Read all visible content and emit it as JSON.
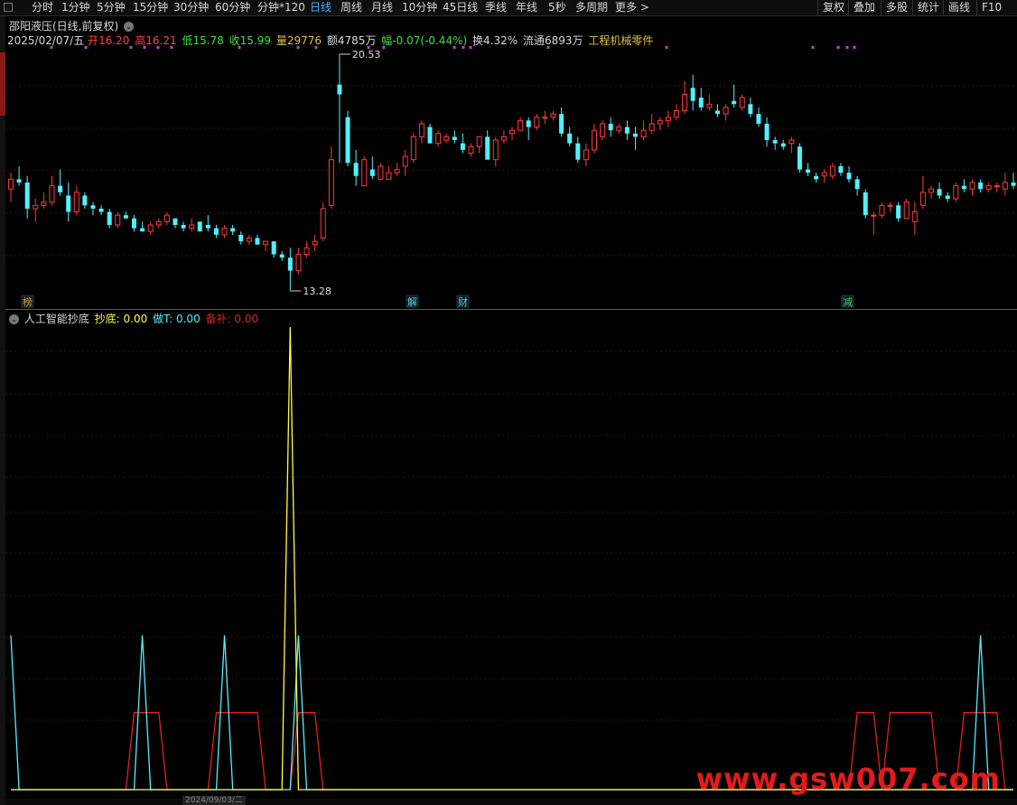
{
  "toolbar": {
    "periods": [
      {
        "label": "分时",
        "active": false
      },
      {
        "label": "1分钟",
        "active": false
      },
      {
        "label": "5分钟",
        "active": false
      },
      {
        "label": "15分钟",
        "active": false
      },
      {
        "label": "30分钟",
        "active": false
      },
      {
        "label": "60分钟",
        "active": false
      },
      {
        "label": "分钟*120",
        "active": false
      },
      {
        "label": "日线",
        "active": true
      },
      {
        "label": "周线",
        "active": false
      },
      {
        "label": "月线",
        "active": false
      },
      {
        "label": "10分钟",
        "active": false
      },
      {
        "label": "45日线",
        "active": false
      },
      {
        "label": "季线",
        "active": false
      },
      {
        "label": "年线",
        "active": false
      },
      {
        "label": "5秒",
        "active": false
      },
      {
        "label": "多周期",
        "active": false
      },
      {
        "label": "更多",
        "active": false
      }
    ],
    "right": [
      "复权",
      "叠加",
      "多股",
      "统计",
      "画线",
      "F10"
    ]
  },
  "stock": {
    "title": "邵阳液压(日线,前复权)",
    "date": "2025/02/07/五",
    "open_label": "开",
    "open": "16.20",
    "high_label": "高",
    "high": "16.21",
    "low_label": "低",
    "low": "15.78",
    "close_label": "收",
    "close": "15.99",
    "vol_label": "量",
    "volume": "29776",
    "amount_label": "额",
    "amount": "4785万",
    "change_label": "幅",
    "change": "-0.07(-0.44%)",
    "turnover_label": "换",
    "turnover": "4.32%",
    "float_label": "流通",
    "float_shares": "6893万",
    "industry": "工程机械零件",
    "max_label": "20.53",
    "min_label": "13.28"
  },
  "event_tags": [
    {
      "text": "榜",
      "color": "#e8a040"
    },
    {
      "text": "解",
      "color": "#4fd0e0"
    },
    {
      "text": "财",
      "color": "#4fd0e0"
    },
    {
      "text": "减",
      "color": "#50d050"
    }
  ],
  "indicator": {
    "name": "人工智能抄底",
    "l1_label": "抄底:",
    "l1_value": "0.00",
    "l2_label": "做T:",
    "l2_value": "0.00",
    "l3_label": "备补:",
    "l3_value": "0.00"
  },
  "date_axis": {
    "tick": "2024/09/03/二"
  },
  "watermark": "www.gsw007.com",
  "colors": {
    "up": "#ff3a3a",
    "down": "#52f0ff",
    "chaodi": "#ffff40",
    "zuot": "#52f0ff",
    "beibu": "#e02020"
  },
  "chart_data": [
    {
      "type": "candlestick",
      "title": "邵阳液压(日线,前复权)",
      "ylim": [
        13.28,
        20.53
      ],
      "max_value": 20.53,
      "min_value": 13.28,
      "candles": [
        [
          16.4,
          16.9,
          16.0,
          16.7
        ],
        [
          16.7,
          17.1,
          16.5,
          16.6
        ],
        [
          16.6,
          16.8,
          15.5,
          15.8
        ],
        [
          15.8,
          16.1,
          15.4,
          15.9
        ],
        [
          15.9,
          16.3,
          15.8,
          16.0
        ],
        [
          16.0,
          16.8,
          15.9,
          16.5
        ],
        [
          16.5,
          17.0,
          16.2,
          16.3
        ],
        [
          16.2,
          16.6,
          15.4,
          15.7
        ],
        [
          15.7,
          16.5,
          15.6,
          16.3
        ],
        [
          16.2,
          16.3,
          15.8,
          15.9
        ],
        [
          15.9,
          16.0,
          15.6,
          15.8
        ],
        [
          15.8,
          15.9,
          15.6,
          15.7
        ],
        [
          15.7,
          15.8,
          15.2,
          15.3
        ],
        [
          15.3,
          15.7,
          15.2,
          15.6
        ],
        [
          15.6,
          15.7,
          15.5,
          15.5
        ],
        [
          15.5,
          15.6,
          15.1,
          15.2
        ],
        [
          15.2,
          15.4,
          15.1,
          15.1
        ],
        [
          15.1,
          15.4,
          15.0,
          15.3
        ],
        [
          15.3,
          15.5,
          15.2,
          15.4
        ],
        [
          15.4,
          15.7,
          15.3,
          15.6
        ],
        [
          15.5,
          15.5,
          15.2,
          15.3
        ],
        [
          15.3,
          15.4,
          15.1,
          15.2
        ],
        [
          15.2,
          15.5,
          15.1,
          15.3
        ],
        [
          15.4,
          15.4,
          15.1,
          15.1
        ],
        [
          15.3,
          15.6,
          15.1,
          15.2
        ],
        [
          15.2,
          15.3,
          14.9,
          15.0
        ],
        [
          15.0,
          15.3,
          14.9,
          15.2
        ],
        [
          15.2,
          15.3,
          15.0,
          15.1
        ],
        [
          15.0,
          15.1,
          14.7,
          14.8
        ],
        [
          14.8,
          15.0,
          14.7,
          14.9
        ],
        [
          14.9,
          15.0,
          14.7,
          14.7
        ],
        [
          14.7,
          14.8,
          14.5,
          14.8
        ],
        [
          14.8,
          14.8,
          14.3,
          14.4
        ],
        [
          14.4,
          14.5,
          14.2,
          14.3
        ],
        [
          14.3,
          14.6,
          13.28,
          13.9
        ],
        [
          13.9,
          14.6,
          13.8,
          14.4
        ],
        [
          14.4,
          14.8,
          14.3,
          14.6
        ],
        [
          14.7,
          15.0,
          14.5,
          14.8
        ],
        [
          14.9,
          16.0,
          14.8,
          15.8
        ],
        [
          15.9,
          17.7,
          15.8,
          17.3
        ],
        [
          19.6,
          20.53,
          17.2,
          19.3
        ],
        [
          18.6,
          18.8,
          17.1,
          17.2
        ],
        [
          17.2,
          17.6,
          16.5,
          16.8
        ],
        [
          16.5,
          17.4,
          16.5,
          17.3
        ],
        [
          17.0,
          17.4,
          16.7,
          16.8
        ],
        [
          16.7,
          17.2,
          16.7,
          17.1
        ],
        [
          16.7,
          17.1,
          16.7,
          16.9
        ],
        [
          16.9,
          17.2,
          16.8,
          17.0
        ],
        [
          17.1,
          17.6,
          16.8,
          17.4
        ],
        [
          17.3,
          18.1,
          17.2,
          18.0
        ],
        [
          18.0,
          18.5,
          17.8,
          18.4
        ],
        [
          18.3,
          18.4,
          17.8,
          17.8
        ],
        [
          17.8,
          18.2,
          17.7,
          18.1
        ],
        [
          17.9,
          18.1,
          17.8,
          18.0
        ],
        [
          18.0,
          18.2,
          17.8,
          17.9
        ],
        [
          17.8,
          18.1,
          17.5,
          17.6
        ],
        [
          17.5,
          17.8,
          17.4,
          17.7
        ],
        [
          17.7,
          18.0,
          17.5,
          18.0
        ],
        [
          18.0,
          18.2,
          17.4,
          17.3
        ],
        [
          17.3,
          18.0,
          17.1,
          17.9
        ],
        [
          17.9,
          18.2,
          17.8,
          18.0
        ],
        [
          18.1,
          18.3,
          17.9,
          18.2
        ],
        [
          18.2,
          18.6,
          18.2,
          18.5
        ],
        [
          18.5,
          18.6,
          17.9,
          18.3
        ],
        [
          18.3,
          18.7,
          18.2,
          18.6
        ],
        [
          18.6,
          18.8,
          18.4,
          18.6
        ],
        [
          18.6,
          18.8,
          18.5,
          18.7
        ],
        [
          18.7,
          18.9,
          18.0,
          18.1
        ],
        [
          18.1,
          18.3,
          17.7,
          17.8
        ],
        [
          17.8,
          18.0,
          17.2,
          17.3
        ],
        [
          17.3,
          17.8,
          17.1,
          17.6
        ],
        [
          17.6,
          18.4,
          17.5,
          18.2
        ],
        [
          18.0,
          18.5,
          17.9,
          18.4
        ],
        [
          18.4,
          18.6,
          18.0,
          18.2
        ],
        [
          18.2,
          18.4,
          18.1,
          18.3
        ],
        [
          18.3,
          18.5,
          17.9,
          18.1
        ],
        [
          18.1,
          18.3,
          17.6,
          18.0
        ],
        [
          18.0,
          18.5,
          17.9,
          18.2
        ],
        [
          18.2,
          18.7,
          18.1,
          18.4
        ],
        [
          18.4,
          18.6,
          18.2,
          18.5
        ],
        [
          18.5,
          18.8,
          18.3,
          18.6
        ],
        [
          18.6,
          19.0,
          18.5,
          18.8
        ],
        [
          18.8,
          19.7,
          18.7,
          19.3
        ],
        [
          19.5,
          19.9,
          18.8,
          19.1
        ],
        [
          19.2,
          19.5,
          18.8,
          18.9
        ],
        [
          18.9,
          19.3,
          18.8,
          19.0
        ],
        [
          18.8,
          19.0,
          18.6,
          18.7
        ],
        [
          18.7,
          19.0,
          18.5,
          18.9
        ],
        [
          19.1,
          19.6,
          18.9,
          19.0
        ],
        [
          18.9,
          19.3,
          18.8,
          19.2
        ],
        [
          19.0,
          19.2,
          18.6,
          18.7
        ],
        [
          18.7,
          18.9,
          18.3,
          18.4
        ],
        [
          18.4,
          18.6,
          17.7,
          17.9
        ],
        [
          17.9,
          18.0,
          17.6,
          17.8
        ],
        [
          17.8,
          17.9,
          17.6,
          17.7
        ],
        [
          17.8,
          18.0,
          17.5,
          17.9
        ],
        [
          17.7,
          17.8,
          16.9,
          17.0
        ],
        [
          17.0,
          17.2,
          16.8,
          16.9
        ],
        [
          16.8,
          16.9,
          16.6,
          16.7
        ],
        [
          16.8,
          17.0,
          16.6,
          16.9
        ],
        [
          16.8,
          17.2,
          16.7,
          17.1
        ],
        [
          17.1,
          17.2,
          16.8,
          16.9
        ],
        [
          16.9,
          17.1,
          16.6,
          16.7
        ],
        [
          16.7,
          16.8,
          16.2,
          16.4
        ],
        [
          16.3,
          16.4,
          15.5,
          15.6
        ],
        [
          15.6,
          15.7,
          15.0,
          15.6
        ],
        [
          15.6,
          16.0,
          15.5,
          15.9
        ],
        [
          15.9,
          16.0,
          15.7,
          15.9
        ],
        [
          15.9,
          16.0,
          15.4,
          15.5
        ],
        [
          15.5,
          16.1,
          15.5,
          16.0
        ],
        [
          15.4,
          16.0,
          15.0,
          15.7
        ],
        [
          15.9,
          16.8,
          15.8,
          16.3
        ],
        [
          16.3,
          16.5,
          16.1,
          16.4
        ],
        [
          16.4,
          16.6,
          16.1,
          16.2
        ],
        [
          16.2,
          16.3,
          16.0,
          16.1
        ],
        [
          16.1,
          16.6,
          16.0,
          16.5
        ],
        [
          16.5,
          16.7,
          16.3,
          16.4
        ],
        [
          16.4,
          16.7,
          16.2,
          16.6
        ],
        [
          16.6,
          16.7,
          16.3,
          16.4
        ],
        [
          16.4,
          16.6,
          16.3,
          16.5
        ],
        [
          16.5,
          16.6,
          16.3,
          16.5
        ],
        [
          16.4,
          16.9,
          16.2,
          16.6
        ],
        [
          16.6,
          16.9,
          16.4,
          16.5
        ]
      ]
    },
    {
      "type": "line",
      "title": "人工智能抄底",
      "ylim": [
        0,
        3
      ],
      "series": [
        {
          "name": "抄底",
          "spikes": [
            {
              "index": 34,
              "value": 3
            }
          ]
        },
        {
          "name": "做T",
          "spikes": [
            {
              "index": 0,
              "value": 1
            },
            {
              "index": 16,
              "value": 1
            },
            {
              "index": 26,
              "value": 1
            },
            {
              "index": 35,
              "value": 1
            },
            {
              "index": 118,
              "value": 1
            }
          ]
        },
        {
          "name": "备补",
          "plateaus": [
            {
              "start": 15,
              "end": 18,
              "value": 0.5
            },
            {
              "start": 25,
              "end": 27,
              "value": 0.5
            },
            {
              "start": 28,
              "end": 30,
              "value": 0.5
            },
            {
              "start": 35,
              "end": 37,
              "value": 0.5
            },
            {
              "start": 103,
              "end": 105,
              "value": 0.5
            },
            {
              "start": 107,
              "end": 109,
              "value": 0.5
            },
            {
              "start": 110,
              "end": 112,
              "value": 0.5
            },
            {
              "start": 116,
              "end": 120,
              "value": 0.5
            }
          ]
        }
      ]
    }
  ]
}
